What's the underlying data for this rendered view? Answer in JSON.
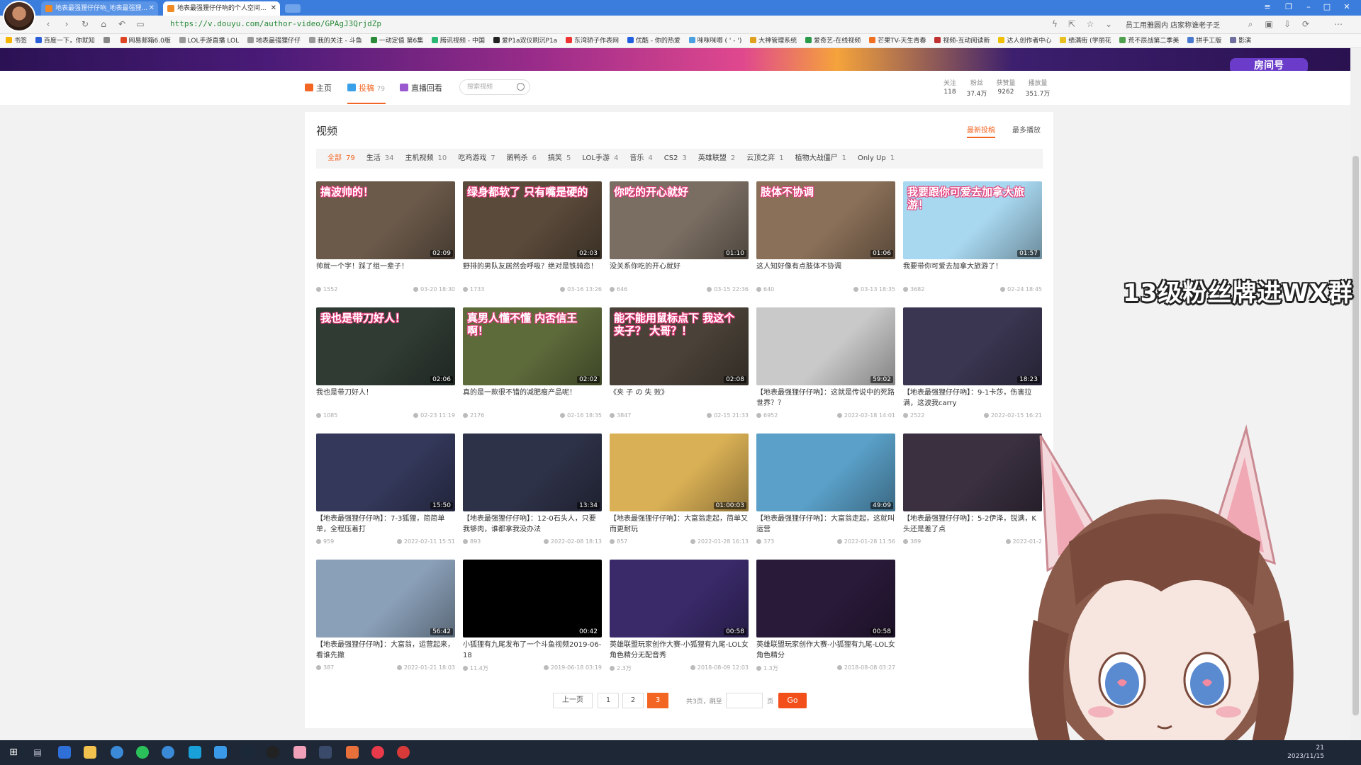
{
  "browser": {
    "tabs": [
      {
        "title": "地表最强狸仔仔吶_地表最强狸..."
      },
      {
        "title": "地表最强狸仔仔吶的个人空间..."
      }
    ],
    "url": "https://v.douyu.com/author-video/GPAgJ3QrjdZp",
    "address_right_text": "员工用雅圆内 店家称谁老子乏",
    "bookmarks": [
      "书签",
      "百度一下，你就知",
      "",
      "网易邮箱6.0版",
      "LOL手游直播 LOL",
      "地表最强狸仔仔",
      "我的关注 - 斗鱼",
      "一动定值 第6集",
      "腾讯视频 - 中国",
      "爱P1a双仪刷沉P1a",
      "东湾骄子作表网",
      "优酷 - 你的热爱",
      "咪咪咪唧 ( ' - ')",
      "大神管理系统",
      "爱奇艺-在线视频",
      "芒果TV-天生青春",
      "视频-互动阅读新",
      "达人创作者中心",
      "绩满街 (学丽花",
      "荒不辰战第二季美",
      "拼手工版",
      "影演"
    ]
  },
  "nav": {
    "home": "主页",
    "uploads": "投稿",
    "uploads_count": "79",
    "replays": "直播回看",
    "search_placeholder": "搜索视频"
  },
  "stats": [
    {
      "label": "关注",
      "value": "118"
    },
    {
      "label": "粉丝",
      "value": "37.4万"
    },
    {
      "label": "获赞量",
      "value": "9262"
    },
    {
      "label": "播放量",
      "value": "351.7万"
    }
  ],
  "section": {
    "title": "视频",
    "sort_latest": "最新投稿",
    "sort_most": "最多播放"
  },
  "categories": [
    {
      "name": "全部",
      "count": "79"
    },
    {
      "name": "生活",
      "count": "34"
    },
    {
      "name": "主机视频",
      "count": "10"
    },
    {
      "name": "吃鸡游戏",
      "count": "7"
    },
    {
      "name": "鹅鸭杀",
      "count": "6"
    },
    {
      "name": "搞笑",
      "count": "5"
    },
    {
      "name": "LOL手游",
      "count": "4"
    },
    {
      "name": "音乐",
      "count": "4"
    },
    {
      "name": "CS2",
      "count": "3"
    },
    {
      "name": "英雄联盟",
      "count": "2"
    },
    {
      "name": "云顶之弈",
      "count": "1"
    },
    {
      "name": "植物大战僵尸",
      "count": "1"
    },
    {
      "name": "Only Up",
      "count": "1"
    }
  ],
  "videos": [
    {
      "overlay": "搞波帅的！",
      "duration": "02:09",
      "title": "帅就一个字！踩了组一辈子！",
      "views": "1552",
      "date": "03-20 18:30",
      "thumb_color": "#6b5a4a"
    },
    {
      "overlay": "绿身都软了 只有嘴是硬的",
      "duration": "02:03",
      "title": "野排的男队友居然会呼吸？绝对是铁骑恋！",
      "views": "1733",
      "date": "03-16 13:26",
      "thumb_color": "#5a4a3a"
    },
    {
      "overlay": "你吃的开心就好",
      "duration": "01:10",
      "title": "没关系你吃的开心就好",
      "views": "646",
      "date": "03-15 22:36",
      "thumb_color": "#7a6e62"
    },
    {
      "overlay": "肢体不协调",
      "duration": "01:06",
      "title": "这人知好像有点肢体不协调",
      "views": "640",
      "date": "03-13 18:35",
      "thumb_color": "#8a7058"
    },
    {
      "overlay": "我要跟你可爱去加拿大旅游！",
      "duration": "01:57",
      "title": "我要带你可爱去加拿大旅游了！",
      "views": "3682",
      "date": "02-24 18:45",
      "thumb_color": "#a8d8f0"
    },
    {
      "overlay": "我也是带刀好人！",
      "duration": "02:06",
      "title": "我也是带刀好人！",
      "views": "1085",
      "date": "02-23 11:19",
      "thumb_color": "#2f3b33"
    },
    {
      "overlay": "真男人懂不懂 内否信王啊！",
      "duration": "02:02",
      "title": "真的是一款很不错的减肥瘦产品呢！",
      "views": "2176",
      "date": "02-16 18:35",
      "thumb_color": "#5d6a3a"
    },
    {
      "overlay": "能不能用鼠标点下 我这个夹子？ 大哥？！",
      "duration": "02:08",
      "title": "《夹 子 の 失 败》",
      "views": "3847",
      "date": "02-15 21:33",
      "thumb_color": "#4a4238"
    },
    {
      "overlay": "",
      "duration": "59:02",
      "title": "【地表最强狸仔仔吶】：这就是传说中的死路世界？？",
      "views": "6952",
      "date": "2022-02-18 14:01",
      "thumb_color": "#c9c9c9"
    },
    {
      "overlay": "",
      "duration": "18:23",
      "title": "【地表最强狸仔仔吶】：9-1卡莎，伤害拉满，这波我carry",
      "views": "2522",
      "date": "2022-02-15 16:21",
      "thumb_color": "#3a3550"
    },
    {
      "overlay": "",
      "duration": "15:50",
      "title": "【地表最强狸仔仔吶】：7-3狐狸，简简单单，全程压着打",
      "views": "959",
      "date": "2022-02-11 15:51",
      "thumb_color": "#34385a"
    },
    {
      "overlay": "",
      "duration": "13:34",
      "title": "【地表最强狸仔仔吶】：12-0石头人，只要我够肉，谁都拿我没办法",
      "views": "893",
      "date": "2022-02-08 18:13",
      "thumb_color": "#2e3248"
    },
    {
      "overlay": "",
      "duration": "01:00:03",
      "title": "【地表最强狸仔仔吶】：大富翁走起，简单又而更耐玩",
      "views": "857",
      "date": "2022-01-28 16:13",
      "thumb_color": "#d9b055"
    },
    {
      "overlay": "",
      "duration": "49:09",
      "title": "【地表最强狸仔仔吶】：大富翁走起，这就叫运营",
      "views": "373",
      "date": "2022-01-28 11:56",
      "thumb_color": "#5aa0c8"
    },
    {
      "overlay": "",
      "duration": "",
      "title": "【地表最强狸仔仔吶】：5-2伊泽，锐满，K头还是差了点",
      "views": "389",
      "date": "2022-01-2",
      "thumb_color": "#3a3040"
    },
    {
      "overlay": "",
      "duration": "56:42",
      "title": "【地表最强狸仔仔吶】：大富翁，运营起来，看谁先撤",
      "views": "387",
      "date": "2022-01-21 18:03",
      "thumb_color": "#8aa0b8"
    },
    {
      "overlay": "",
      "duration": "00:42",
      "title": "小狐狸有九尾发布了一个斗鱼视频2019-06-18",
      "views": "11.4万",
      "date": "2019-06-18 03:19",
      "thumb_color": "#000000"
    },
    {
      "overlay": "",
      "duration": "00:58",
      "title": "英雄联盟玩家创作大赛-小狐狸有九尾-LOL女角色精分无配音秀",
      "views": "2.3万",
      "date": "2018-08-09 12:03",
      "thumb_color": "#3a2a6a"
    },
    {
      "overlay": "",
      "duration": "00:58",
      "title": "英雄联盟玩家创作大赛-小狐狸有九尾-LOL女角色精分",
      "views": "1.3万",
      "date": "2018-08-08 03:27",
      "thumb_color": "#2a1a3a"
    }
  ],
  "pagination": {
    "prev": "上一页",
    "pages": [
      "1",
      "2",
      "3"
    ],
    "current": "3",
    "total_label": "共3页，跳至",
    "page_unit": "页",
    "go": "Go"
  },
  "overlay_text": "13级粉丝牌进WX群",
  "taskbar": {
    "time": "21",
    "date": "2023/11/15"
  },
  "colors": {
    "accent": "#f26522",
    "go_button": "#f24f1b",
    "browser_blue": "#3b7ddd"
  }
}
